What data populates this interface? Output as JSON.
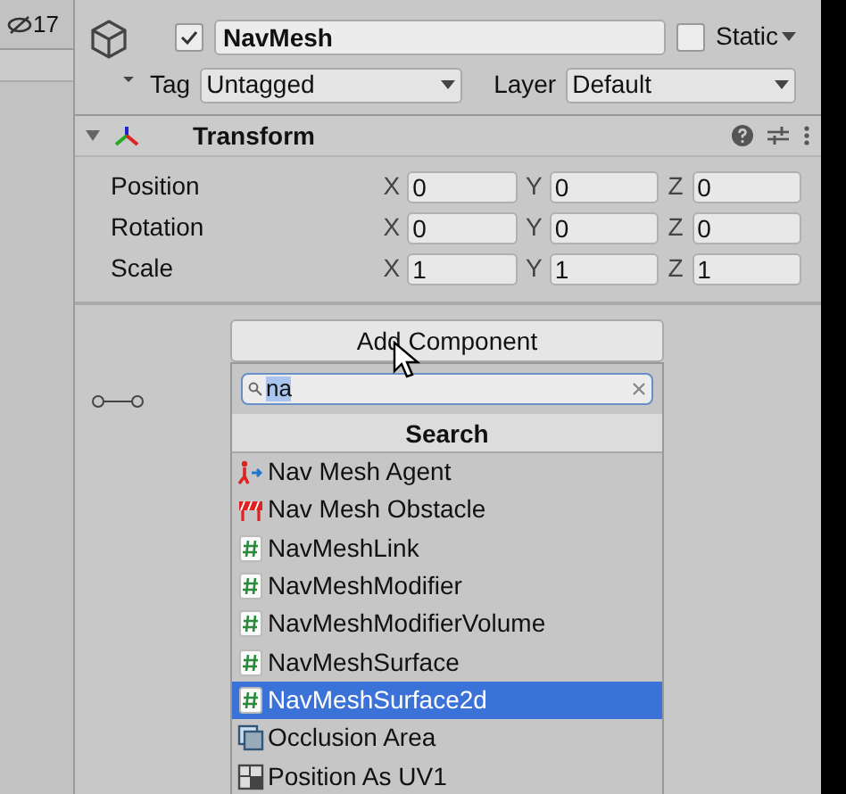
{
  "hierarchy": {
    "count": "17"
  },
  "header": {
    "active": true,
    "name": "NavMesh",
    "static": false,
    "static_label": "Static",
    "tag_label": "Tag",
    "tag": "Untagged",
    "layer_label": "Layer",
    "layer": "Default"
  },
  "transform": {
    "expanded": true,
    "title": "Transform",
    "rows": [
      {
        "label": "Position",
        "fields": [
          {
            "axis": "X",
            "value": "0"
          },
          {
            "axis": "Y",
            "value": "0"
          },
          {
            "axis": "Z",
            "value": "0"
          }
        ]
      },
      {
        "label": "Rotation",
        "fields": [
          {
            "axis": "X",
            "value": "0"
          },
          {
            "axis": "Y",
            "value": "0"
          },
          {
            "axis": "Z",
            "value": "0"
          }
        ]
      },
      {
        "label": "Scale",
        "fields": [
          {
            "axis": "X",
            "value": "1"
          },
          {
            "axis": "Y",
            "value": "1"
          },
          {
            "axis": "Z",
            "value": "1"
          }
        ]
      }
    ]
  },
  "add_component": {
    "label": "Add Component",
    "search": "na",
    "section": "Search",
    "items": [
      {
        "kind": "agent",
        "label": "Nav Mesh Agent",
        "selected": false
      },
      {
        "kind": "obstacle",
        "label": "Nav Mesh Obstacle",
        "selected": false
      },
      {
        "kind": "script",
        "label": "NavMeshLink",
        "selected": false
      },
      {
        "kind": "script",
        "label": "NavMeshModifier",
        "selected": false
      },
      {
        "kind": "script",
        "label": "NavMeshModifierVolume",
        "selected": false
      },
      {
        "kind": "script",
        "label": "NavMeshSurface",
        "selected": false
      },
      {
        "kind": "script",
        "label": "NavMeshSurface2d",
        "selected": true
      },
      {
        "kind": "occlusion",
        "label": "Occlusion Area",
        "selected": false
      },
      {
        "kind": "uv",
        "label": "Position As UV1",
        "selected": false
      }
    ]
  }
}
